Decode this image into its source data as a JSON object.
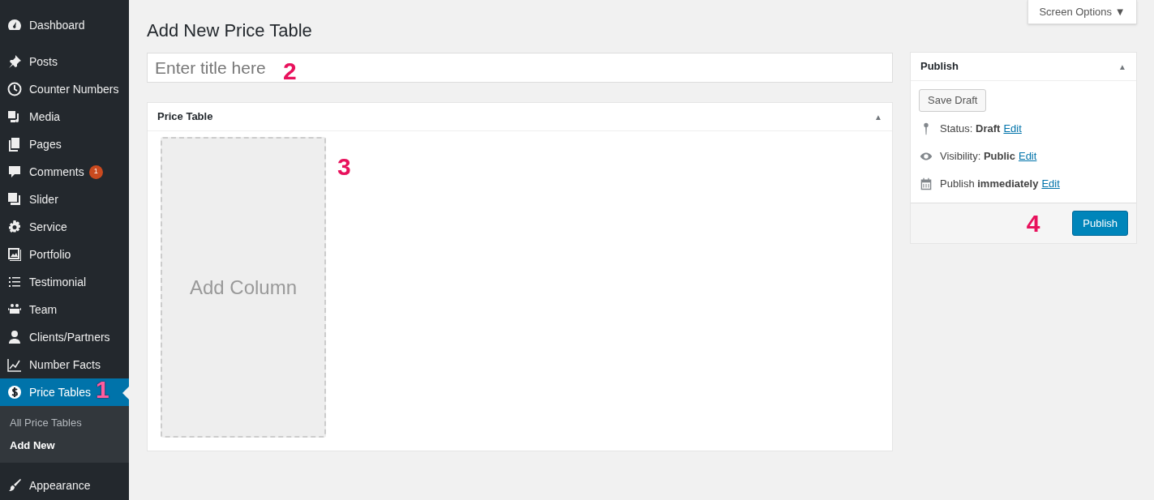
{
  "sidebar": {
    "groups": [
      {
        "items": [
          {
            "label": "Dashboard",
            "selected": false
          }
        ]
      },
      {
        "items": [
          {
            "label": "Posts",
            "selected": false
          },
          {
            "label": "Counter Numbers",
            "selected": false
          },
          {
            "label": "Media",
            "selected": false
          },
          {
            "label": "Pages",
            "selected": false
          },
          {
            "label": "Comments",
            "selected": false,
            "badge": "1"
          },
          {
            "label": "Slider",
            "selected": false
          },
          {
            "label": "Service",
            "selected": false
          },
          {
            "label": "Portfolio",
            "selected": false
          },
          {
            "label": "Testimonial",
            "selected": false
          },
          {
            "label": "Team",
            "selected": false
          },
          {
            "label": "Clients/Partners",
            "selected": false
          },
          {
            "label": "Number Facts",
            "selected": false
          },
          {
            "label": "Price Tables",
            "selected": true,
            "annotation": "1",
            "children": [
              {
                "label": "All Price Tables",
                "selected": false
              },
              {
                "label": "Add New",
                "selected": true
              }
            ]
          }
        ]
      },
      {
        "items": [
          {
            "label": "Appearance",
            "selected": false
          }
        ]
      }
    ]
  },
  "screen_options": "Screen Options ▼",
  "page_title": "Add New Price Table",
  "title_field": {
    "placeholder": "Enter title here",
    "annotation": "2"
  },
  "price_table_box": {
    "title": "Price Table",
    "toggle": "▲",
    "add_column": "Add Column",
    "annotation": "3"
  },
  "publish_box": {
    "title": "Publish",
    "toggle": "▲",
    "save_draft": "Save Draft",
    "rows": [
      {
        "text": "Status: **Draft**",
        "link": "Edit"
      },
      {
        "text": "Visibility: **Public**",
        "link": "Edit"
      },
      {
        "text": "Publish **immediately**",
        "link": "Edit"
      }
    ],
    "annotation": "4",
    "publish_button": "Publish"
  }
}
